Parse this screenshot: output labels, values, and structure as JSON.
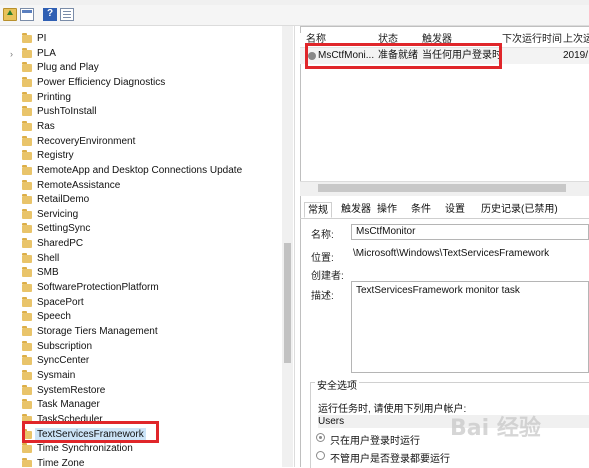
{
  "tree": {
    "items": [
      {
        "label": "PI",
        "expandable": false
      },
      {
        "label": "PLA",
        "expandable": true
      },
      {
        "label": "Plug and Play",
        "expandable": false
      },
      {
        "label": "Power Efficiency Diagnostics",
        "expandable": false
      },
      {
        "label": "Printing",
        "expandable": false
      },
      {
        "label": "PushToInstall",
        "expandable": false
      },
      {
        "label": "Ras",
        "expandable": false
      },
      {
        "label": "RecoveryEnvironment",
        "expandable": false
      },
      {
        "label": "Registry",
        "expandable": false
      },
      {
        "label": "RemoteApp and Desktop Connections Update",
        "expandable": false
      },
      {
        "label": "RemoteAssistance",
        "expandable": false
      },
      {
        "label": "RetailDemo",
        "expandable": false
      },
      {
        "label": "Servicing",
        "expandable": false
      },
      {
        "label": "SettingSync",
        "expandable": false
      },
      {
        "label": "SharedPC",
        "expandable": false
      },
      {
        "label": "Shell",
        "expandable": false
      },
      {
        "label": "SMB",
        "expandable": false
      },
      {
        "label": "SoftwareProtectionPlatform",
        "expandable": false
      },
      {
        "label": "SpacePort",
        "expandable": false
      },
      {
        "label": "Speech",
        "expandable": false
      },
      {
        "label": "Storage Tiers Management",
        "expandable": false
      },
      {
        "label": "Subscription",
        "expandable": false
      },
      {
        "label": "SyncCenter",
        "expandable": false
      },
      {
        "label": "Sysmain",
        "expandable": false
      },
      {
        "label": "SystemRestore",
        "expandable": false
      },
      {
        "label": "Task Manager",
        "expandable": false
      },
      {
        "label": "TaskScheduler",
        "expandable": false
      },
      {
        "label": "TextServicesFramework",
        "expandable": false,
        "selected": true
      },
      {
        "label": "Time Synchronization",
        "expandable": false
      },
      {
        "label": "Time Zone",
        "expandable": false
      }
    ]
  },
  "task_list": {
    "columns": [
      "名称",
      "状态",
      "触发器",
      "下次运行时间",
      "上次运"
    ],
    "row": {
      "name": "MsCtfMoni...",
      "status": "准备就绪",
      "trigger": "当任何用户登录时",
      "last_run": "2019/"
    }
  },
  "tabs": [
    "常规",
    "触发器",
    "操作",
    "条件",
    "设置",
    "历史记录(已禁用)"
  ],
  "general": {
    "name_label": "名称:",
    "name_value": "MsCtfMonitor",
    "location_label": "位置:",
    "location_value": "\\Microsoft\\Windows\\TextServicesFramework",
    "author_label": "创建者:",
    "description_label": "描述:",
    "description_value": "TextServicesFramework monitor task"
  },
  "security": {
    "title": "安全选项",
    "run_as_label": "运行任务时, 请使用下列用户帐户:",
    "user": "Users",
    "option_logged_on": "只在用户登录时运行",
    "option_whether": "不管用户是否登录都要运行"
  },
  "toolbar": {
    "help_glyph": "?"
  },
  "colors": {
    "highlight": "#e0262a",
    "folder": "#e9c46a"
  }
}
